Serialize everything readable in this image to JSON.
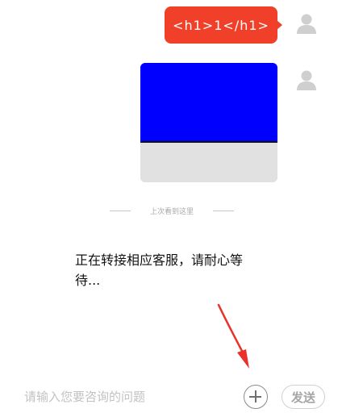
{
  "chat": {
    "messages": [
      {
        "sender": "user",
        "type": "text",
        "text": "<h1>1</h1>",
        "bubble_color": "#f0402a",
        "avatar_icon": "user-avatar-icon"
      },
      {
        "sender": "user",
        "type": "image",
        "image_colors": {
          "top": "#0000ff",
          "bottom": "#e1e1e1"
        },
        "avatar_icon": "user-avatar-icon"
      }
    ],
    "last_read_label": "上次看到这里",
    "system_message": "正在转接相应客服，请耐心等待..."
  },
  "input_bar": {
    "placeholder": "请输入您要咨询的问题",
    "value": "",
    "plus_icon": "plus-circle-icon",
    "send_label": "发送"
  },
  "annotation": {
    "type": "arrow",
    "color": "#e8322a",
    "points_to": "plus-button"
  }
}
